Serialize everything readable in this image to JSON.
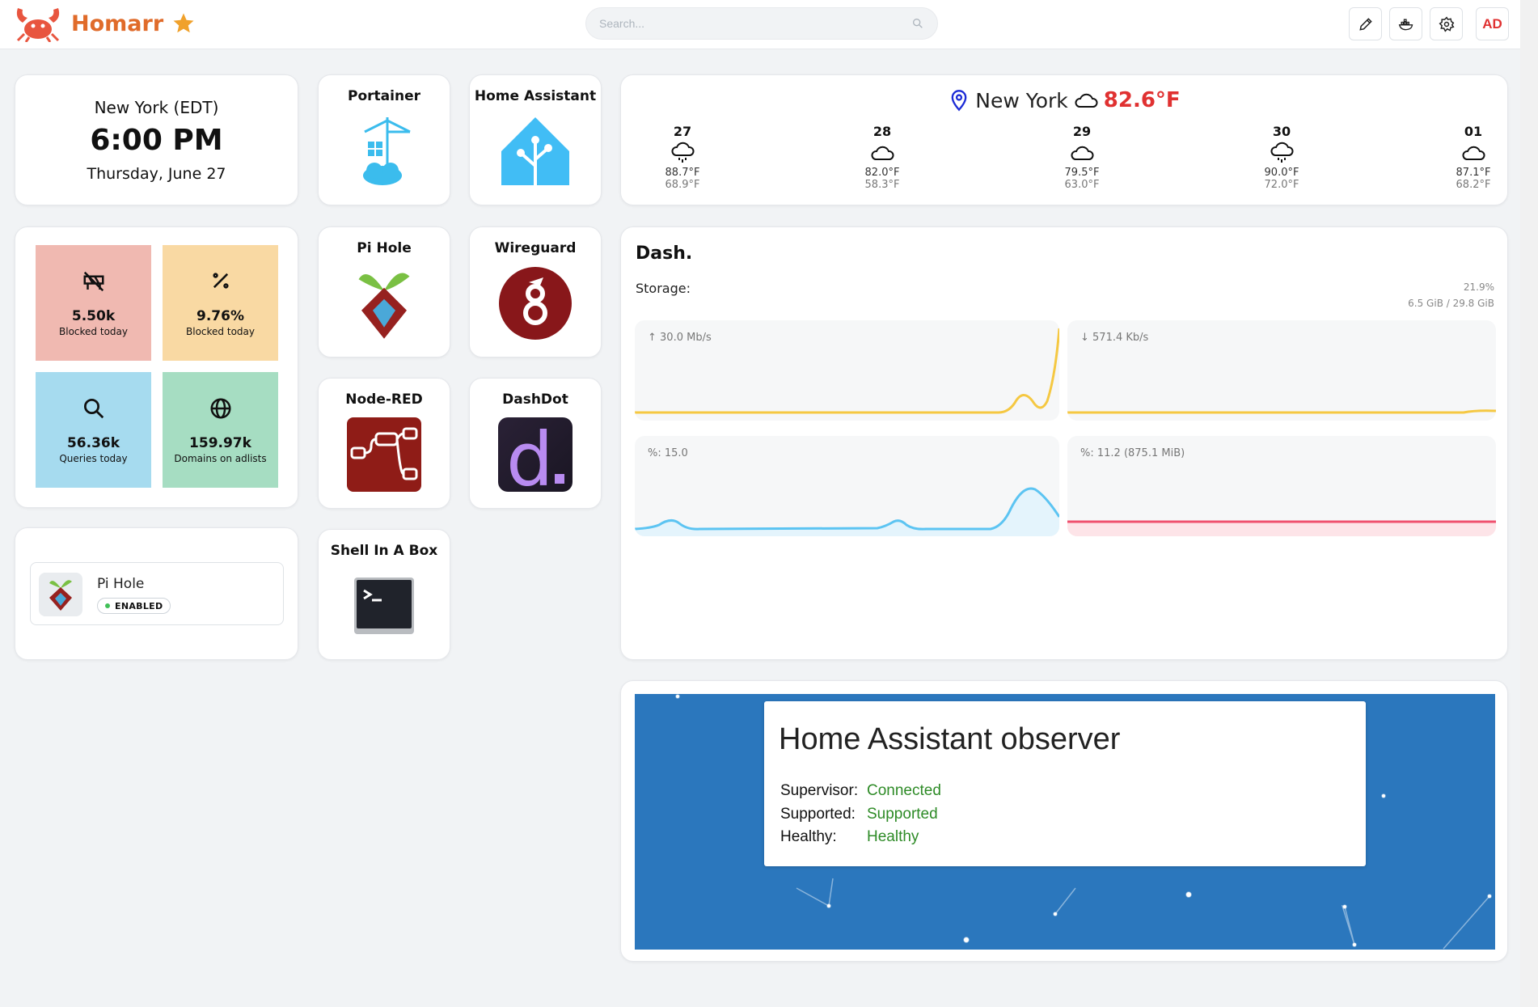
{
  "header": {
    "app_name": "Homarr",
    "search_placeholder": "Search...",
    "avatar_initials": "AD",
    "actions": [
      "edit",
      "docker",
      "settings"
    ]
  },
  "clock": {
    "timezone": "New York (EDT)",
    "time": "6:00 PM",
    "date": "Thursday, June 27"
  },
  "pihole": {
    "tiles": [
      {
        "value": "5.50k",
        "label": "Blocked today",
        "color": "#f0b9b1",
        "icon": "blocked-barrier-icon"
      },
      {
        "value": "9.76%",
        "label": "Blocked today",
        "color": "#f9d9a3",
        "icon": "percent-icon"
      },
      {
        "value": "56.36k",
        "label": "Queries today",
        "color": "#a6dbef",
        "icon": "search-icon"
      },
      {
        "value": "159.97k",
        "label": "Domains on adlists",
        "color": "#a6ddc2",
        "icon": "www-globe-icon"
      }
    ],
    "status_name": "Pi Hole",
    "status_badge": "ENABLED"
  },
  "apps": [
    {
      "name": "Portainer"
    },
    {
      "name": "Home Assistant"
    },
    {
      "name": "Pi Hole"
    },
    {
      "name": "Wireguard"
    },
    {
      "name": "Node-RED"
    },
    {
      "name": "DashDot"
    },
    {
      "name": "Shell In A Box"
    }
  ],
  "weather": {
    "city": "New York",
    "current_temp": "82.6°F",
    "current_icon": "cloud-icon",
    "days": [
      {
        "day": "27",
        "icon": "cloud-drizzle-icon",
        "max": "88.7°F",
        "min": "68.9°F"
      },
      {
        "day": "28",
        "icon": "cloud-icon",
        "max": "82.0°F",
        "min": "58.3°F"
      },
      {
        "day": "29",
        "icon": "cloud-icon",
        "max": "79.5°F",
        "min": "63.0°F"
      },
      {
        "day": "30",
        "icon": "cloud-drizzle-icon",
        "max": "90.0°F",
        "min": "72.0°F"
      },
      {
        "day": "01",
        "icon": "cloud-icon",
        "max": "87.1°F",
        "min": "68.2°F"
      }
    ]
  },
  "dashdot": {
    "title": "Dash.",
    "storage_label": "Storage:",
    "storage_percent": "21.9%",
    "storage_used": "6.5 GiB / 29.8 GiB",
    "upload_label": "↑ 30.0 Mb/s",
    "download_label": "↓ 571.4 Kb/s",
    "cpu_label": "%: 15.0",
    "ram_label": "%: 11.2 (875.1 MiB)",
    "colors": {
      "network": "#f5c842",
      "cpu": "#5cc4f2",
      "ram": "#f0506e"
    }
  },
  "home_assistant": {
    "title": "Home Assistant observer",
    "rows": [
      {
        "label": "Supervisor:",
        "value": "Connected"
      },
      {
        "label": "Supported:",
        "value": "Supported"
      },
      {
        "label": "Healthy:",
        "value": "Healthy"
      }
    ]
  }
}
